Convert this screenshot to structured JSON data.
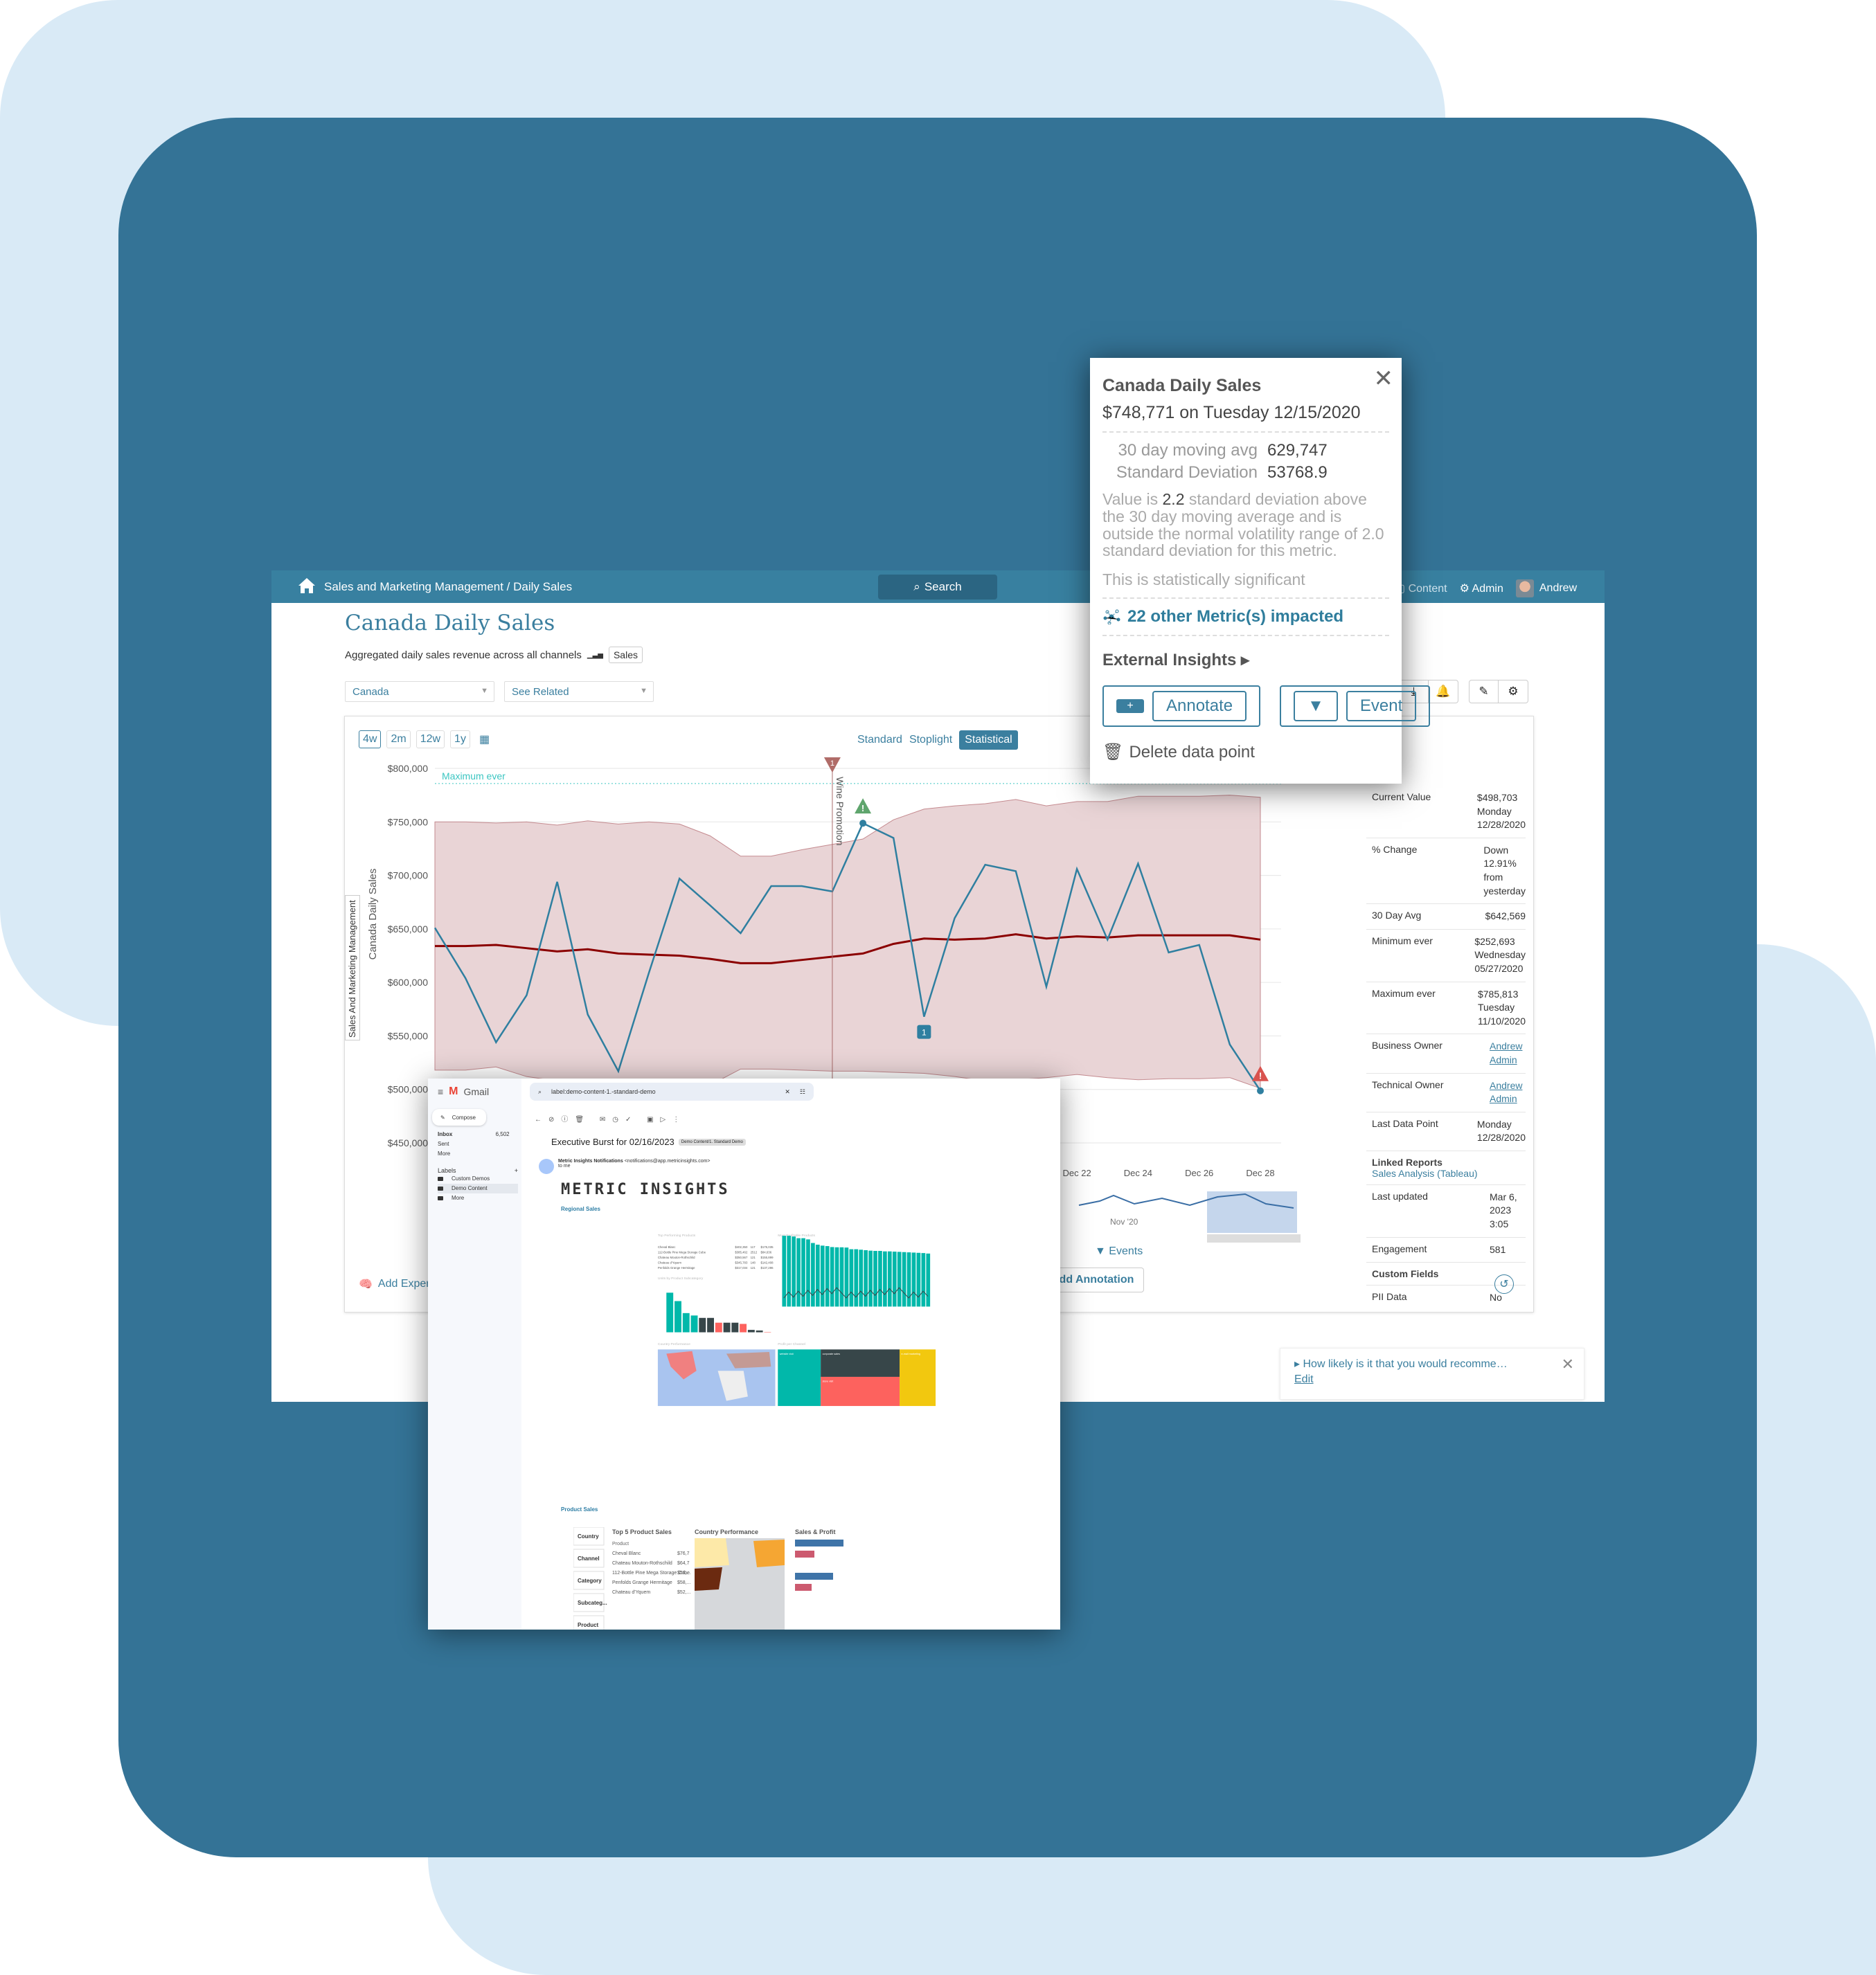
{
  "colors": {
    "bg_light": "#d9eaf6",
    "bg_dark": "#347396",
    "header": "#3880a0",
    "accent": "#3b7f9f",
    "band": "#e9d4d6",
    "avg_line": "#8b0000",
    "series_line": "#2f7fa0",
    "max_line": "#3cc6c2"
  },
  "header": {
    "breadcrumb": "Sales and Marketing Management / Daily Sales",
    "search_label": "Search",
    "content_label": "Content",
    "admin_label": "Admin",
    "user_name": "Andrew"
  },
  "page": {
    "title": "Canada Daily Sales",
    "subtitle": "Aggregated daily sales revenue across all channels",
    "tag": "Sales",
    "dimension_select": "Canada",
    "related_select": "See Related"
  },
  "chart_controls": {
    "ranges": [
      "4w",
      "2m",
      "12w",
      "1y"
    ],
    "active_range": "4w",
    "views": [
      "Standard",
      "Stoplight",
      "Statistical"
    ],
    "active_view": "Statistical"
  },
  "side_tab": "Sales And Marketing Management",
  "chart_data": {
    "type": "line",
    "title": "Canada Daily Sales",
    "ylabel": "Canada Daily Sales",
    "ylim": [
      450000,
      800000
    ],
    "yticks": [
      "$800,000",
      "$750,000",
      "$700,000",
      "$650,000",
      "$600,000",
      "$550,000",
      "$500,000",
      "$450,000"
    ],
    "ytick_values": [
      800000,
      750000,
      700000,
      650000,
      600000,
      550000,
      500000,
      450000
    ],
    "xticks_visible": [
      "Dec 22",
      "Dec 24",
      "Dec 26",
      "Dec 28"
    ],
    "x_days": [
      1,
      2,
      3,
      4,
      5,
      6,
      7,
      8,
      9,
      10,
      11,
      12,
      13,
      14,
      15,
      16,
      17,
      18,
      19,
      20,
      21,
      22,
      23,
      24,
      25,
      26,
      27,
      28
    ],
    "series": [
      {
        "name": "Daily Sales",
        "values": [
          651000,
          604000,
          544000,
          588000,
          694000,
          570000,
          517000,
          609000,
          697000,
          672000,
          646000,
          690000,
          690000,
          685000,
          748771,
          735000,
          568000,
          660000,
          710000,
          704000,
          596000,
          706000,
          640000,
          711000,
          628000,
          635000,
          542000,
          498703
        ]
      },
      {
        "name": "30 Day Moving Avg",
        "values": [
          634000,
          634000,
          635000,
          632000,
          629000,
          631000,
          627000,
          626000,
          625000,
          622000,
          618000,
          618000,
          621000,
          624000,
          627000,
          636000,
          641000,
          640000,
          641000,
          645000,
          641000,
          643000,
          642000,
          644000,
          644000,
          644000,
          644000,
          640000
        ]
      },
      {
        "name": "Upper Band",
        "values": [
          750000,
          750000,
          749000,
          750000,
          747000,
          751000,
          748000,
          750000,
          748000,
          737000,
          718000,
          718000,
          724000,
          729000,
          734000,
          752000,
          762000,
          765000,
          767000,
          771000,
          765000,
          769000,
          769000,
          774000,
          774000,
          774000,
          775000,
          773000
        ]
      },
      {
        "name": "Lower Band",
        "values": [
          518000,
          518000,
          521000,
          512000,
          508000,
          506000,
          508000,
          507000,
          507000,
          504000,
          519000,
          519000,
          518000,
          517000,
          517000,
          516000,
          515000,
          512000,
          508000,
          509000,
          511000,
          514000,
          511000,
          509000,
          510000,
          510000,
          511000,
          501000
        ]
      }
    ],
    "reference_lines": [
      {
        "label": "Maximum ever",
        "value": 785813
      }
    ],
    "annotations": [
      {
        "type": "event",
        "label": "Wine Promotion",
        "number": "1",
        "day": 14
      },
      {
        "type": "alert-green",
        "day": 15
      },
      {
        "type": "note",
        "number": "1",
        "day": 17
      },
      {
        "type": "alert-red",
        "day": 28
      }
    ],
    "navigator_label": "Nov '20",
    "legend": [
      "Events"
    ]
  },
  "stats": [
    {
      "key": "Current Value",
      "value": [
        "$498,703",
        "Monday",
        "12/28/2020"
      ]
    },
    {
      "key": "% Change",
      "value": [
        "Down 12.91% from yesterday"
      ]
    },
    {
      "key": "30 Day Avg",
      "value": [
        "$642,569"
      ]
    },
    {
      "key": "Minimum ever",
      "value": [
        "$252,693",
        "Wednesday",
        "05/27/2020"
      ]
    },
    {
      "key": "Maximum ever",
      "value": [
        "$785,813",
        "Tuesday",
        "11/10/2020"
      ]
    },
    {
      "key": "Business Owner",
      "value": [
        "Andrew Admin"
      ],
      "link": true
    },
    {
      "key": "Technical Owner",
      "value": [
        "Andrew Admin"
      ],
      "link": true
    },
    {
      "key": "Last Data Point",
      "value": [
        "Monday",
        "12/28/2020"
      ]
    }
  ],
  "linked_reports": {
    "title": "Linked Reports",
    "item": "Sales Analysis (Tableau)"
  },
  "stats2": [
    {
      "key": "Last updated",
      "value": "Mar 6, 2023 3:05"
    },
    {
      "key": "Engagement",
      "value": "581"
    }
  ],
  "custom_fields": {
    "title": "Custom Fields",
    "items": [
      {
        "key": "PII Data",
        "value": "No"
      }
    ]
  },
  "bottom": {
    "add_expert": "Add Expert",
    "events_legend": "Events",
    "annotation_btn": "Add Annotation"
  },
  "feedback": {
    "question": "How likely is it that you would recomme…",
    "edit": "Edit"
  },
  "popup": {
    "title": "Canada Daily Sales",
    "value_line": "$748,771 on Tuesday 12/15/2020",
    "moving_avg_label": "30 day moving avg",
    "moving_avg": "629,747",
    "std_label": "Standard Deviation",
    "std": "53768.9",
    "desc_pre": "Value is ",
    "desc_num": "2.2",
    "desc_post": " standard deviation above the 30 day moving average and is outside the normal volatility range of 2.0 standard deviation for this metric.",
    "significance": "This is statistically significant",
    "impacted": "22 other Metric(s) impacted",
    "external": "External Insights",
    "annotate": "Annotate",
    "event": "Event",
    "delete": "Delete data point"
  },
  "gmail": {
    "app": "Gmail",
    "compose": "Compose",
    "nav": [
      {
        "label": "Inbox",
        "count": "6,502"
      },
      {
        "label": "Sent"
      },
      {
        "label": "More"
      }
    ],
    "labels_title": "Labels",
    "labels": [
      "Custom Demos",
      "Demo Content",
      "More"
    ],
    "search": "label:demo-content-1.-standard-demo",
    "subject": "Executive Burst for 02/16/2023",
    "chip": "Demo Content/1. Standard Demo",
    "sender": "Metric Insights Notifications",
    "sender_email": "<notifications@app.metricinsights.com>",
    "to": "to me",
    "logo": "METRIC INSIGHTS",
    "section1": "Regional Sales",
    "section2": "Product Sales",
    "pbi_titles": [
      "Top Performing Products",
      "Most Profitable Products",
      "Units by Product Subcategory",
      "Country Performance",
      "Profit per Channel"
    ],
    "top_products": [
      [
        "Cheval Blanc",
        "$402,350",
        "117",
        "$175,035"
      ],
      [
        "112-Bottle Pine Mega Storage Cube",
        "$385,462",
        "2512",
        "$84,636"
      ],
      [
        "Chateau Mouton-Rothschild",
        "$350,567",
        "121",
        "$155,899"
      ],
      [
        "Chateau d'Yquem",
        "$345,783",
        "148",
        "$142,408"
      ],
      [
        "Penfolds Grange Hermitage",
        "$317,034",
        "121",
        "$137,286"
      ]
    ],
    "units_bars": [
      33,
      26,
      16,
      14,
      12,
      12,
      8,
      8,
      8,
      7,
      2,
      1.5,
      0.3
    ],
    "units_colors": [
      "#01b8aa",
      "#01b8aa",
      "#01b8aa",
      "#01b8aa",
      "#374649",
      "#374649",
      "#fd625e",
      "#374649",
      "#374649",
      "#fd625e",
      "#374649",
      "#374649",
      "#fd625e"
    ],
    "profit_bars": [
      2.95,
      2.95,
      2.92,
      2.85,
      2.85,
      2.8,
      2.65,
      2.58,
      2.54,
      2.52,
      2.48,
      2.47,
      2.47,
      2.46,
      2.39,
      2.39,
      2.37,
      2.35,
      2.33,
      2.32,
      2.32,
      2.3,
      2.3,
      2.29,
      2.28,
      2.27,
      2.26,
      2.25,
      2.24,
      2.23,
      2.21
    ],
    "channels": [
      "website visit",
      "corporate sales",
      "store visit",
      "e-mail marketing"
    ],
    "qlik_filters": [
      "Country",
      "Channel",
      "Category",
      "Subcateg...",
      "Product"
    ],
    "qlik_titles": [
      "Top 5 Product Sales",
      "Country Performance",
      "Sales & Profit"
    ],
    "qlik_col": "Product",
    "qlik_rows": [
      [
        "Cheval Blanc",
        "$76,7"
      ],
      [
        "Chateau Mouton-Rothschild",
        "$64,7"
      ],
      [
        "112-Bottle Pine Mega Storage Cube",
        "$59,..."
      ],
      [
        "Penfolds Grange Hermitage",
        "$58,..."
      ],
      [
        "Chateau d'Yquem",
        "$52,..."
      ]
    ]
  }
}
